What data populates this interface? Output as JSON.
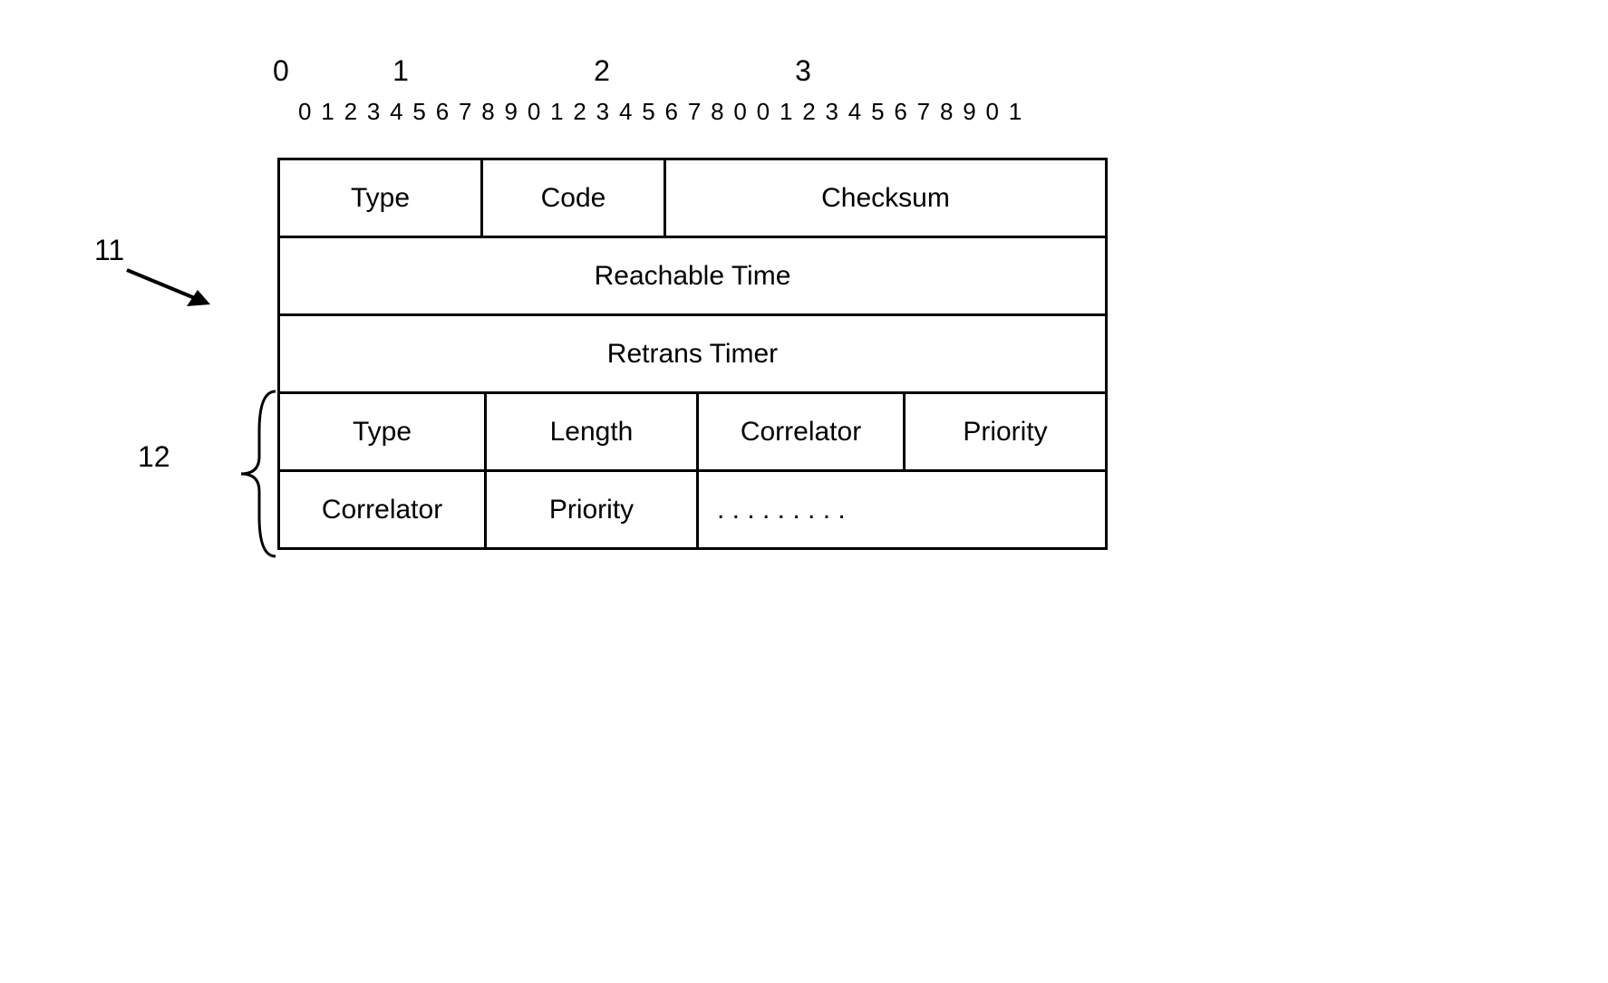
{
  "rulerMajor": [
    "0",
    "1",
    "2",
    "3"
  ],
  "rulerMinor": "0 1 2 3 4 5 6 7 8 9 0 1 2 3 4 5 6 7 8 0 0 1 2 3 4 5 6 7 8 9 0 1",
  "row1": {
    "c1": "Type",
    "c2": "Code",
    "c3": "Checksum"
  },
  "row2": "Reachable Time",
  "row3": "Retrans Timer",
  "row4": {
    "c1": "Type",
    "c2": "Length",
    "c3": "Correlator",
    "c4": "Priority"
  },
  "row5": {
    "c1": "Correlator",
    "c2": "Priority",
    "c3": ". . . . . . . . ."
  },
  "labels": {
    "l11": "11",
    "l12": "12"
  }
}
